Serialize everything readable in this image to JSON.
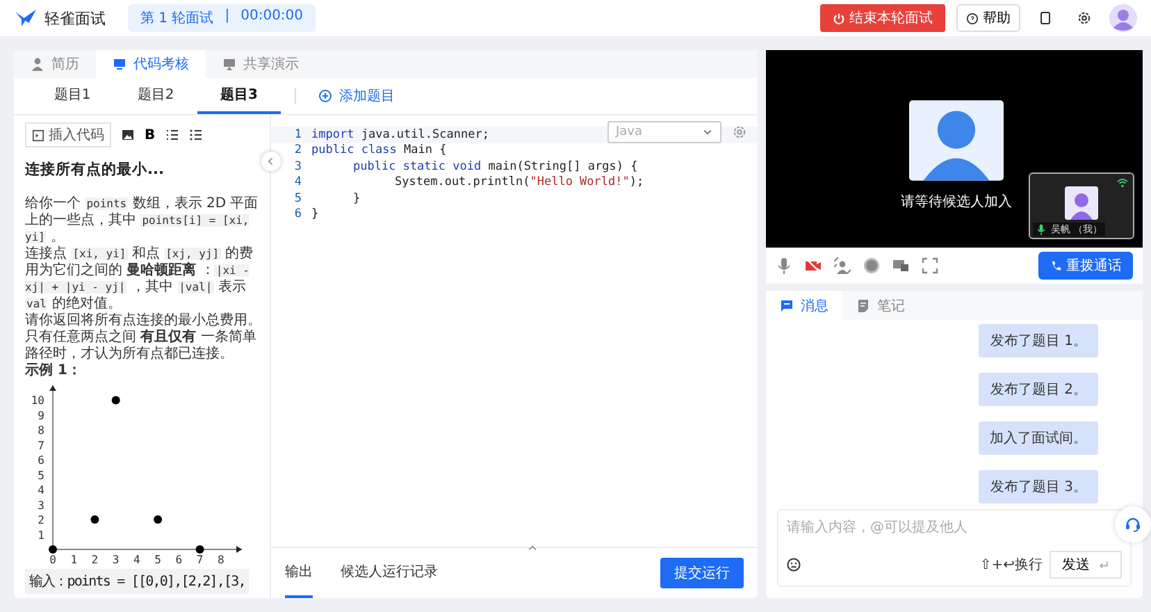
{
  "header": {
    "logo_text": "轻雀面试",
    "round_badge": "第 1 轮面试",
    "separator": "|",
    "timer": "00:00:00",
    "end_button": "结束本轮面试",
    "help_button": "帮助"
  },
  "main_tabs": [
    {
      "label": "简历",
      "selected": false
    },
    {
      "label": "代码考核",
      "selected": true
    },
    {
      "label": "共享演示",
      "selected": false
    }
  ],
  "problem_tabs": [
    {
      "label": "题目1",
      "selected": false
    },
    {
      "label": "题目2",
      "selected": false
    },
    {
      "label": "题目3",
      "selected": true
    }
  ],
  "add_problem": "添加题目",
  "toolbar": {
    "insert_code": "插入代码",
    "bold": "B"
  },
  "problem": {
    "title": "连接所有点的最小...",
    "paragraphs": [
      [
        {
          "kind": "text",
          "text": "给你一个 "
        },
        {
          "kind": "code",
          "text": "points"
        },
        {
          "kind": "text",
          "text": " 数组，表示 2D 平面上的一些点，其中 "
        },
        {
          "kind": "code",
          "text": "points[i] = [xi, yi]"
        },
        {
          "kind": "text",
          "text": " 。"
        }
      ],
      [
        {
          "kind": "text",
          "text": "连接点 "
        },
        {
          "kind": "code",
          "text": "[xi, yi]"
        },
        {
          "kind": "text",
          "text": " 和点 "
        },
        {
          "kind": "code",
          "text": "[xj, yj]"
        },
        {
          "kind": "text",
          "text": " 的费用为它们之间的 "
        },
        {
          "kind": "bold",
          "text": "曼哈顿距离"
        },
        {
          "kind": "text",
          "text": " ："
        },
        {
          "kind": "code",
          "text": "|xi - xj| + |yi - yj|"
        },
        {
          "kind": "text",
          "text": " ，其中 "
        },
        {
          "kind": "code",
          "text": "|val|"
        },
        {
          "kind": "text",
          "text": " 表示 "
        },
        {
          "kind": "code",
          "text": "val"
        },
        {
          "kind": "text",
          "text": " 的绝对值。"
        }
      ],
      [
        {
          "kind": "text",
          "text": "请你返回将所有点连接的最小总费用。只有任意两点之间 "
        },
        {
          "kind": "bold",
          "text": "有且仅有"
        },
        {
          "kind": "text",
          "text": " 一条简单路径时，才认为所有点都已连接。"
        }
      ],
      [
        {
          "kind": "bold",
          "text": "示例 1："
        }
      ]
    ],
    "chart_data": {
      "type": "scatter",
      "x": [
        0,
        2,
        3,
        5,
        7
      ],
      "values": [
        0,
        2,
        10,
        2,
        0
      ],
      "xlim": [
        0,
        9
      ],
      "ylim": [
        0,
        11
      ],
      "xticks": [
        0,
        1,
        2,
        3,
        4,
        5,
        6,
        7,
        8
      ],
      "yticks": [
        1,
        2,
        3,
        4,
        5,
        6,
        7,
        8,
        9,
        10
      ]
    },
    "example_input": "输入：points = [[0,0],[2,2],[3,"
  },
  "editor": {
    "language": "Java",
    "lines": [
      {
        "number": "1",
        "tokens": [
          {
            "kind": "keyword",
            "text": "import"
          },
          {
            "kind": "plain",
            "text": " java.util.Scanner;"
          }
        ]
      },
      {
        "number": "2",
        "tokens": [
          {
            "kind": "keyword",
            "text": "public class"
          },
          {
            "kind": "plain",
            "text": " Main {"
          }
        ],
        "children": [
          {
            "number": "3",
            "tokens": [
              {
                "kind": "keyword",
                "text": "public static void"
              },
              {
                "kind": "plain",
                "text": " main(String[] args) {"
              }
            ],
            "children": [
              {
                "number": "4",
                "tokens": [
                  {
                    "kind": "plain",
                    "text": "System.out.println("
                  },
                  {
                    "kind": "string",
                    "text": "\"Hello World!\""
                  },
                  {
                    "kind": "plain",
                    "text": ");"
                  }
                ]
              }
            ]
          },
          {
            "number": "5",
            "tokens": [
              {
                "kind": "plain",
                "text": "}"
              }
            ]
          }
        ]
      },
      {
        "number": "6",
        "tokens": [
          {
            "kind": "plain",
            "text": "}"
          }
        ]
      }
    ]
  },
  "output_tabs": [
    {
      "label": "输出",
      "selected": true
    },
    {
      "label": "候选人运行记录",
      "selected": false
    }
  ],
  "submit_button": "提交运行",
  "video": {
    "waiting_text": "请等待候选人加入",
    "self_label": "吴帆 （我）",
    "redial_button": "重拨通话"
  },
  "chat_tabs": [
    {
      "label": "消息",
      "selected": true
    },
    {
      "label": "笔记",
      "selected": false
    }
  ],
  "messages": [
    "发布了题目 1。",
    "发布了题目 2。",
    "加入了面试间。",
    "发布了题目 3。"
  ],
  "composer": {
    "placeholder": "请输入内容，@可以提及他人",
    "newline_hint": "⇧+↩换行",
    "send_button": "发送"
  }
}
